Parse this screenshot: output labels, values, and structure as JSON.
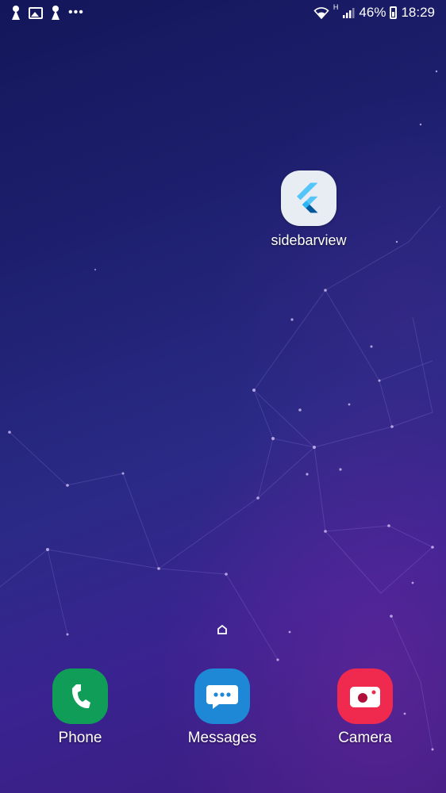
{
  "status_bar": {
    "left_icons": [
      "keyhole-icon",
      "gallery-icon",
      "keyhole-icon",
      "more-dots-icon"
    ],
    "more_dots": "•••",
    "network_type": "H",
    "battery_percent": "46%",
    "time": "18:29"
  },
  "home_apps": [
    {
      "label": "sidebarview",
      "icon": "flutter-icon"
    }
  ],
  "dock": [
    {
      "label": "Phone",
      "icon": "phone-icon",
      "color": "#0f9d58"
    },
    {
      "label": "Messages",
      "icon": "messages-icon",
      "color": "#1e88d6"
    },
    {
      "label": "Camera",
      "icon": "camera-icon",
      "color": "#f0294f"
    }
  ],
  "colors": {
    "flutter_light": "#54c5f8",
    "flutter_dark": "#01579b"
  }
}
